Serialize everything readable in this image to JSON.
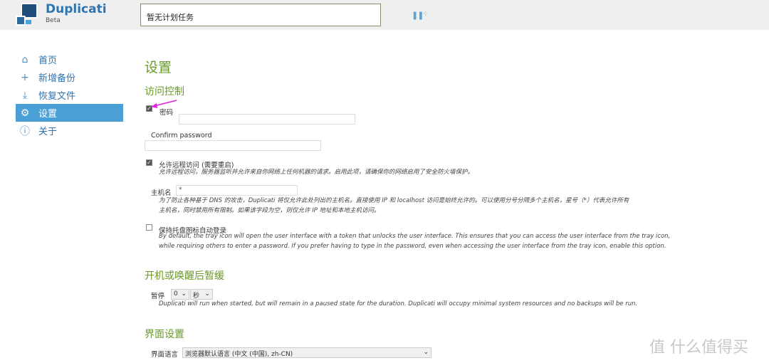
{
  "header": {
    "brand": "Duplicati",
    "edition": "Beta",
    "status": "暂无计划任务",
    "pause_icon": "pause-icon",
    "spinner_icon": "throttle-icon"
  },
  "nav": {
    "items": [
      {
        "label": "首页",
        "icon": "⌂"
      },
      {
        "label": "新增备份",
        "icon": "+"
      },
      {
        "label": "恢复文件",
        "icon": "⤓"
      },
      {
        "label": "设置",
        "icon": "⚙"
      },
      {
        "label": "关于",
        "icon": "ⓘ"
      }
    ]
  },
  "main": {
    "title": "设置",
    "access": {
      "heading": "访问控制",
      "password_label": "密码",
      "password_checked": true,
      "confirm_label": "Confirm password",
      "remote_label": "允许远程访问 (需要重启)",
      "remote_checked": true,
      "remote_desc": "允许远程访问，服务器监听并允许来自你网络上任何机器的请求。启用此项，请确保你的网络启用了安全防火墙保护。",
      "hostname_label": "主机名",
      "hostname_value": "*",
      "hostname_desc1": "为了防止各种基于 DNS 的攻击，Duplicati 将仅允许此处列出的主机名。直接使用 IP 和 localhost 访问是始终允许的。可以使用分号分隔多个主机名，星号（*）代表允许所有",
      "hostname_desc2": "主机名，同时禁用所有限制。如果该字段为空，则仅允许 IP 地址和本地主机访问。",
      "tray_label": "保持托盘图标自动登录",
      "tray_checked": false,
      "tray_desc1": "By default, the tray icon will open the user interface with a token that unlocks the user interface. This ensures that you can access the user interface from the tray icon,",
      "tray_desc2": "while requiring others to enter a password. If you prefer having to type in the password, even when accessing the user interface from the tray icon, enable this option."
    },
    "pause": {
      "heading": "开机或唤醒后暂缓",
      "label": "暂停",
      "amount": "0",
      "unit": "秒",
      "desc": "Duplicati will run when started, but will remain in a paused state for the duration. Duplicati will occupy minimal system resources and no backups will be run."
    },
    "ui": {
      "heading": "界面设置",
      "language_label": "界面语言",
      "language_value": "浏览器默认语言 (中文 (中国), zh-CN)"
    }
  },
  "watermark": "值 什么值得买",
  "colors": {
    "accent": "#4a9fd5",
    "heading": "#6a9a2a",
    "link": "#2e75b0",
    "annotation": "#e020e0"
  }
}
